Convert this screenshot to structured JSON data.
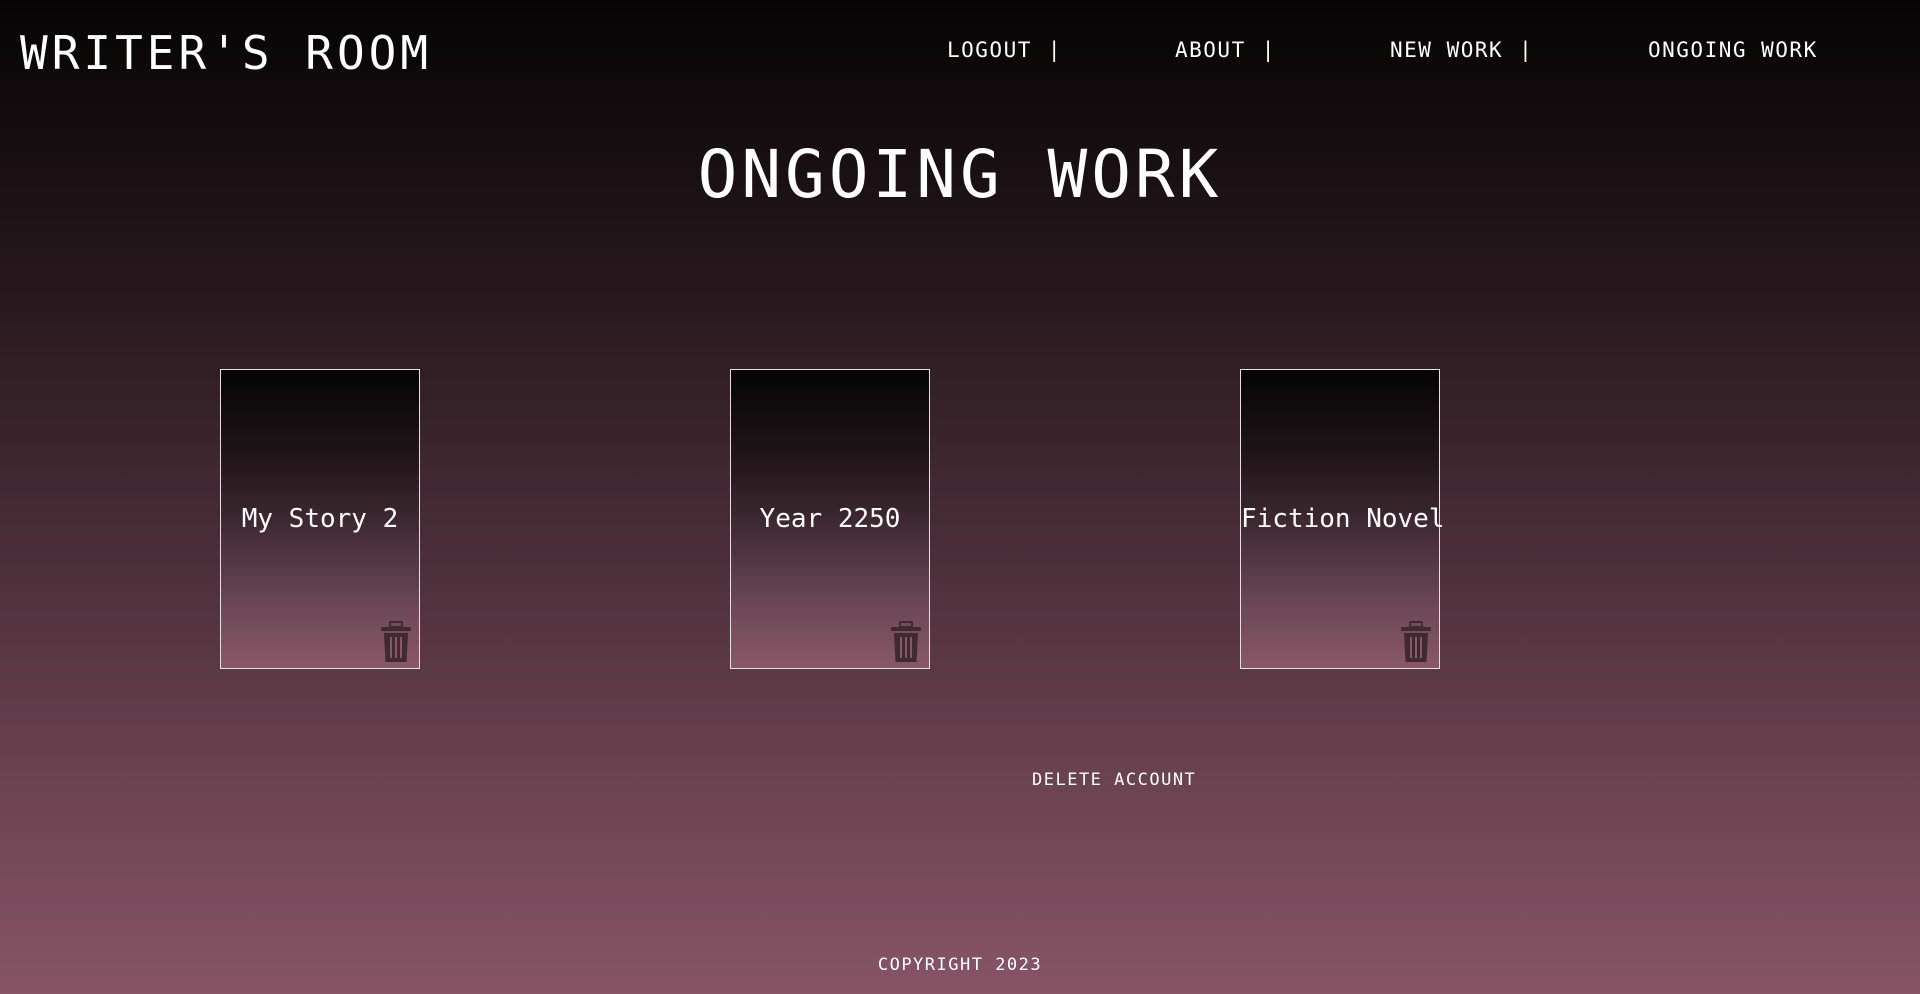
{
  "brand": {
    "logo": "WRITER'S ROOM"
  },
  "nav": {
    "items": [
      {
        "label": "LOGOUT",
        "separator": "|"
      },
      {
        "label": "ABOUT",
        "separator": "|"
      },
      {
        "label": "NEW WORK",
        "separator": "|"
      },
      {
        "label": "ONGOING WORK",
        "separator": ""
      }
    ]
  },
  "main": {
    "title": "ONGOING WORK",
    "works": [
      {
        "title": "My Story 2",
        "action_icon": "trash-icon"
      },
      {
        "title": "Year 2250",
        "action_icon": "trash-icon"
      },
      {
        "title": "Fiction Novel",
        "action_icon": "trash-icon"
      }
    ],
    "delete_account_label": "DELETE ACCOUNT"
  },
  "footer": {
    "text": "COPYRIGHT 2023"
  },
  "colors": {
    "text": "#ffffff",
    "icon": "#3f2a31",
    "card_border": "#e8dde2"
  }
}
